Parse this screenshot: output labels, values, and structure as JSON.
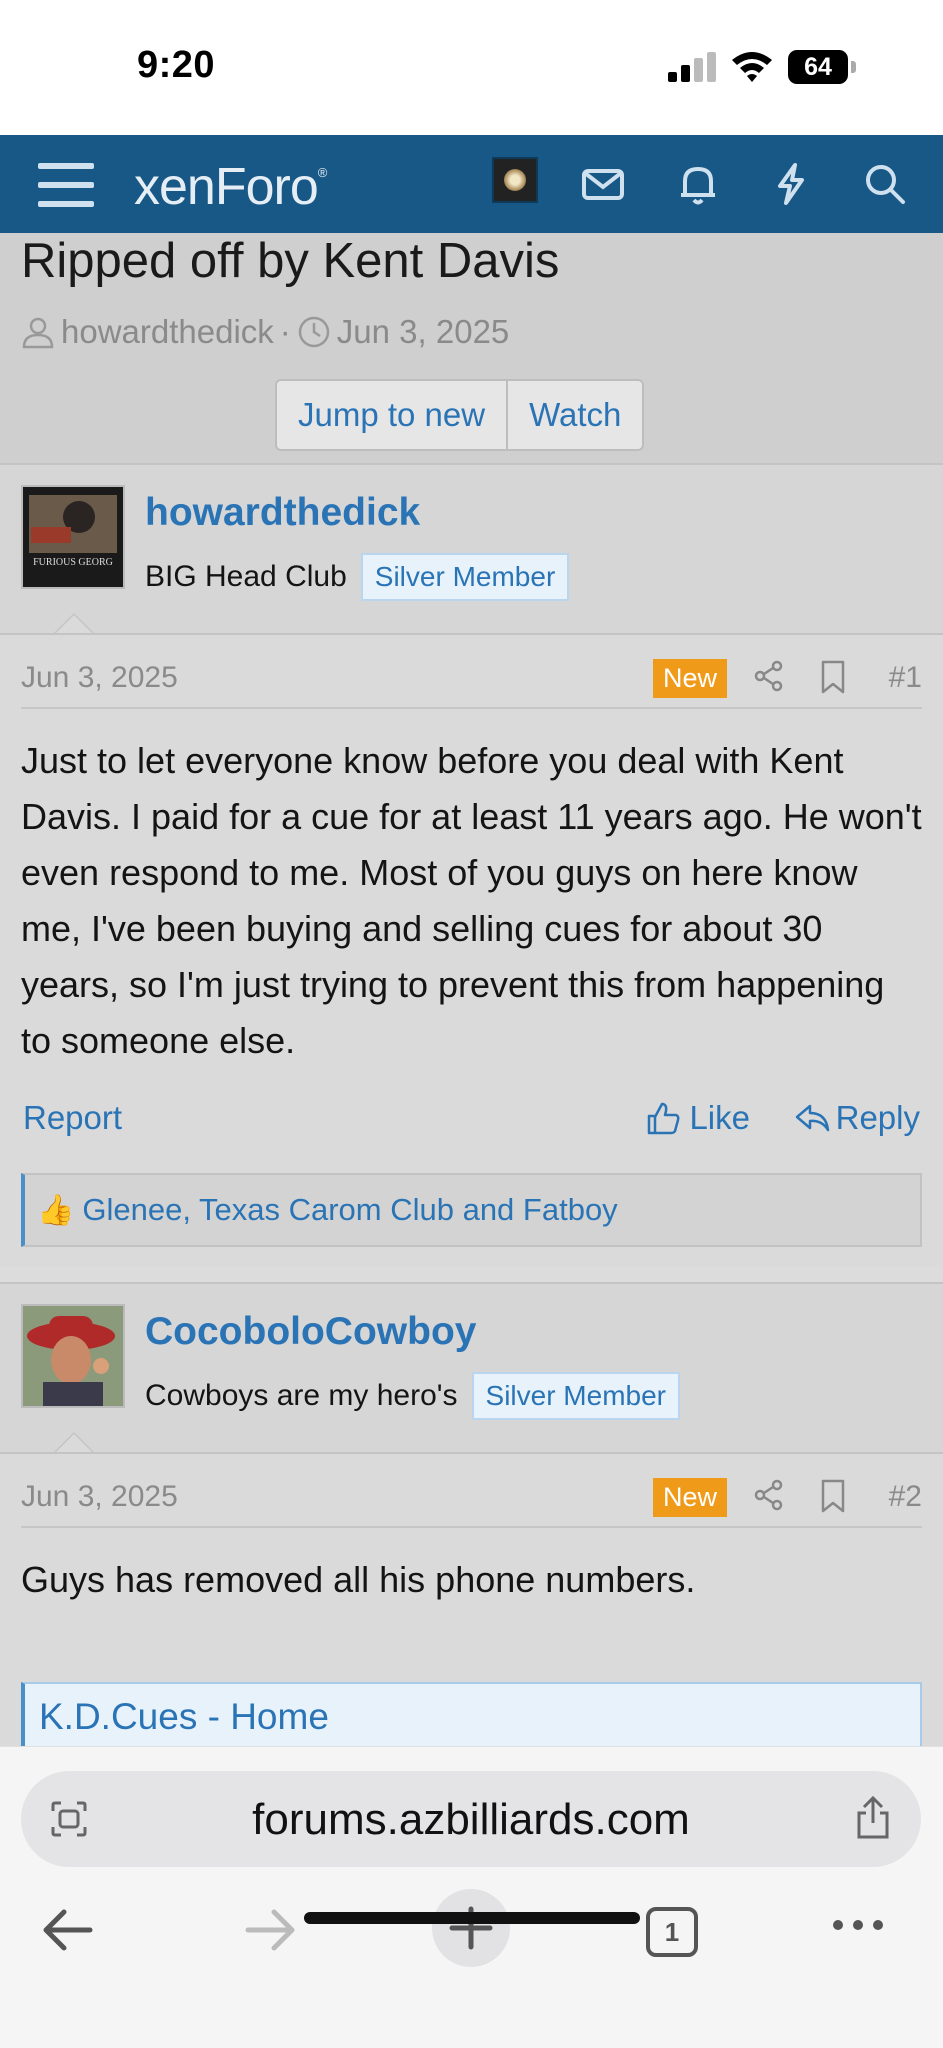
{
  "status": {
    "time": "9:20",
    "battery": "64"
  },
  "nav": {
    "logo": "xenForo",
    "logo_mark": "®"
  },
  "thread": {
    "title": "Ripped off by Kent Davis",
    "author": "howardthedick",
    "separator": "·",
    "date": "Jun 3, 2025",
    "jump_label": "Jump to new",
    "watch_label": "Watch"
  },
  "posts": [
    {
      "username": "howardthedick",
      "user_title": "BIG Head Club",
      "banner": "Silver Member",
      "date": "Jun 3, 2025",
      "badge": "New",
      "number": "#1",
      "message": "Just to let everyone know before you deal with Kent Davis. I paid for a cue for at least 11 years ago. He won't even respond to me. Most of you guys on here know me, I've been buying and selling cues for about 30 years, so I'm just trying to prevent this from happening to someone else.",
      "report": "Report",
      "like": "Like",
      "reply": "Reply",
      "reactions": "Glenee, Texas Carom Club and Fatboy",
      "avatar_caption": "FURIOUS GEORG"
    },
    {
      "username": "CocoboloCowboy",
      "user_title": "Cowboys are my hero's",
      "banner": "Silver Member",
      "date": "Jun 3, 2025",
      "badge": "New",
      "number": "#2",
      "message": "Guys has removed all his phone numbers.",
      "link": "K.D.Cues - Home"
    }
  ],
  "browser": {
    "url": "forums.azbilliards.com",
    "tab_count": "1"
  }
}
